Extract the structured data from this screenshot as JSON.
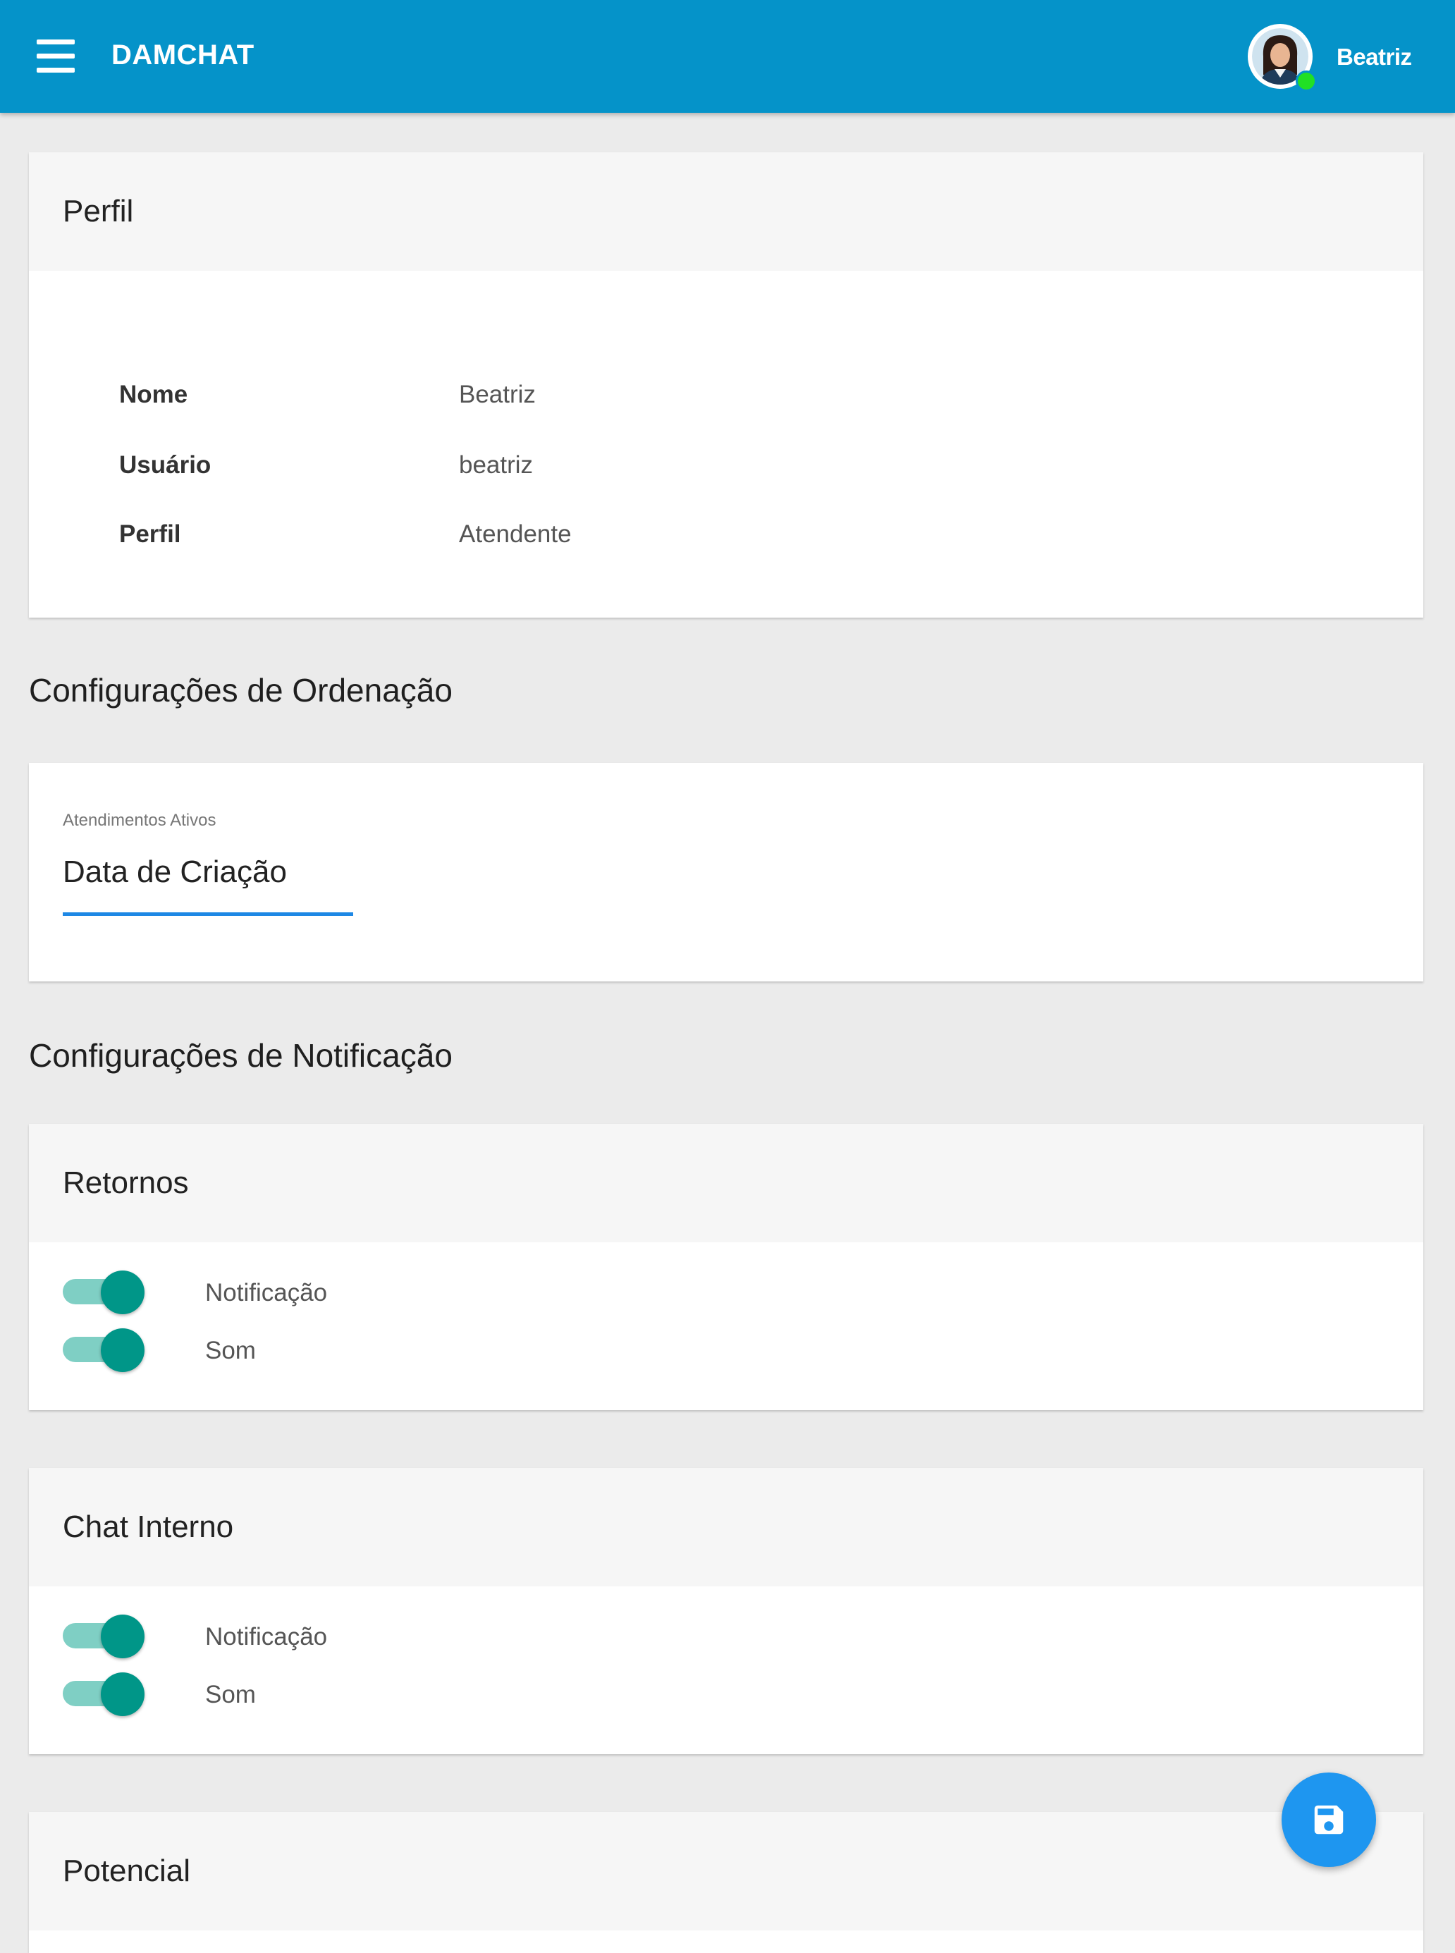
{
  "appbar": {
    "title": "DAMCHAT",
    "user_name": "Beatriz",
    "status_color": "#21e024",
    "color": "#0593c9"
  },
  "profile": {
    "header": "Perfil",
    "rows": [
      {
        "label": "Nome",
        "value": "Beatriz"
      },
      {
        "label": "Usuário",
        "value": "beatriz"
      },
      {
        "label": "Perfil",
        "value": "Atendente"
      }
    ]
  },
  "sorting": {
    "section_title": "Configurações de Ordenação",
    "field_label": "Atendimentos Ativos",
    "selected_value": "Data de Criação"
  },
  "notifications": {
    "section_title": "Configurações de Notificação",
    "groups": [
      {
        "header": "Retornos",
        "toggles": [
          {
            "label": "Notificação",
            "on": true
          },
          {
            "label": "Som",
            "on": true
          }
        ]
      },
      {
        "header": "Chat Interno",
        "toggles": [
          {
            "label": "Notificação",
            "on": true
          },
          {
            "label": "Som",
            "on": true
          }
        ]
      },
      {
        "header": "Potencial"
      }
    ]
  },
  "fab": {
    "icon": "save-icon",
    "color": "#1e96f0"
  }
}
